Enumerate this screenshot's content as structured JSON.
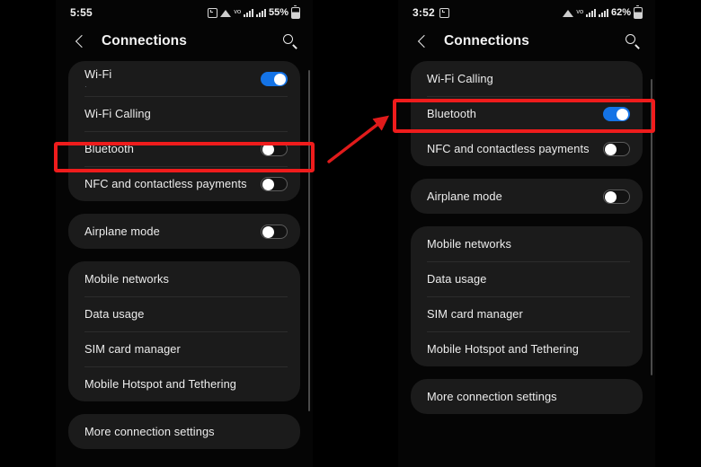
{
  "annotation": {
    "highlight_color": "#ef1c1c",
    "arrow_color": "#e01b1b",
    "left_highlight_target": "Bluetooth",
    "right_highlight_target": "Bluetooth",
    "arrow_name": "red-arrow-before-after"
  },
  "accent": {
    "toggle_on_color": "#1473e6",
    "toggle_off_color": "#121212",
    "card_color": "#1b1b1b",
    "screen_color": "#050505"
  },
  "phones": [
    {
      "id": "left",
      "status": {
        "clock": "5:55",
        "battery_percent": "55%",
        "icons": [
          "alarm-icon",
          "wifi-icon",
          "volte-icon",
          "signal-bars-icon",
          "signal-bars-icon",
          "battery-icon"
        ]
      },
      "appbar": {
        "back": "back-arrow-icon",
        "title": "Connections",
        "search": "search-icon"
      },
      "cards": [
        {
          "rows": [
            {
              "label": "Wi-Fi",
              "sub": "·",
              "toggle": "on"
            },
            {
              "label": "Wi-Fi Calling",
              "sub": "",
              "toggle": "none"
            },
            {
              "label": "Bluetooth",
              "sub": "",
              "toggle": "off"
            },
            {
              "label": "NFC and contactless payments",
              "sub": "",
              "toggle": "off"
            }
          ]
        },
        {
          "rows": [
            {
              "label": "Airplane mode",
              "sub": "",
              "toggle": "off"
            }
          ]
        },
        {
          "rows": [
            {
              "label": "Mobile networks",
              "sub": "",
              "toggle": "none"
            },
            {
              "label": "Data usage",
              "sub": "",
              "toggle": "none"
            },
            {
              "label": "SIM card manager",
              "sub": "",
              "toggle": "none"
            },
            {
              "label": "Mobile Hotspot and Tethering",
              "sub": "",
              "toggle": "none"
            }
          ]
        },
        {
          "rows": [
            {
              "label": "More connection settings",
              "sub": "",
              "toggle": "none"
            }
          ]
        }
      ]
    },
    {
      "id": "right",
      "status": {
        "clock": "3:52",
        "battery_percent": "62%",
        "icons": [
          "alarm-icon",
          "wifi-icon",
          "volte-icon",
          "signal-bars-icon",
          "signal-bars-icon",
          "battery-icon"
        ]
      },
      "appbar": {
        "back": "back-arrow-icon",
        "title": "Connections",
        "search": "search-icon"
      },
      "cards": [
        {
          "rows": [
            {
              "label": "Wi-Fi Calling",
              "sub": "",
              "toggle": "none"
            },
            {
              "label": "Bluetooth",
              "sub": "",
              "toggle": "on"
            },
            {
              "label": "NFC and contactless payments",
              "sub": "",
              "toggle": "off"
            }
          ]
        },
        {
          "rows": [
            {
              "label": "Airplane mode",
              "sub": "",
              "toggle": "off"
            }
          ]
        },
        {
          "rows": [
            {
              "label": "Mobile networks",
              "sub": "",
              "toggle": "none"
            },
            {
              "label": "Data usage",
              "sub": "",
              "toggle": "none"
            },
            {
              "label": "SIM card manager",
              "sub": "",
              "toggle": "none"
            },
            {
              "label": "Mobile Hotspot and Tethering",
              "sub": "",
              "toggle": "none"
            }
          ]
        },
        {
          "rows": [
            {
              "label": "More connection settings",
              "sub": "",
              "toggle": "none"
            }
          ]
        }
      ]
    }
  ]
}
